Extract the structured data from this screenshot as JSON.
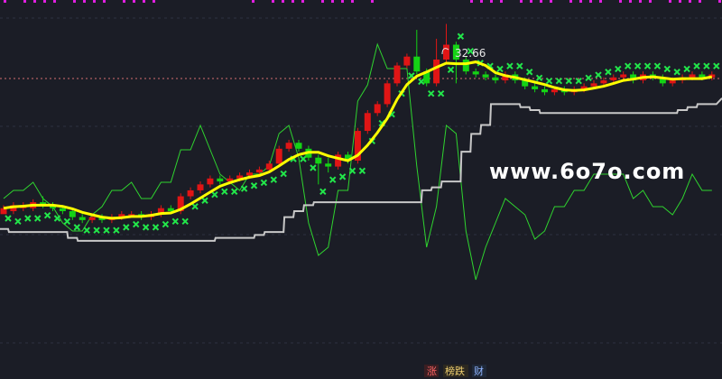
{
  "chart_data": {
    "type": "candlestick",
    "high_marker": "32.66",
    "watermark": "www.6o7o.com",
    "bottom_tabs": [
      "涨",
      "榜跌",
      "财"
    ],
    "colors": {
      "up": "#e01515",
      "down": "#15d315",
      "ma": "#ffff00",
      "lower": "#c8c8c8",
      "osc": "#2fd42f",
      "sar": "#22e64a",
      "ref": "#d67070"
    },
    "candles": [
      [
        56,
        58,
        59,
        57
      ],
      [
        57,
        59,
        60,
        56
      ],
      [
        58,
        59,
        60,
        57
      ],
      [
        58,
        60,
        61,
        57
      ],
      [
        60,
        59,
        62,
        58
      ],
      [
        59,
        58,
        60,
        57
      ],
      [
        58,
        57,
        59,
        56
      ],
      [
        57,
        55,
        58,
        54
      ],
      [
        55,
        54,
        56,
        53
      ],
      [
        54,
        55,
        56,
        53
      ],
      [
        55,
        54,
        56,
        53
      ],
      [
        54,
        55,
        56,
        53
      ],
      [
        55,
        56,
        57,
        54
      ],
      [
        56,
        56,
        57,
        55
      ],
      [
        56,
        55,
        57,
        54
      ],
      [
        55,
        56,
        57,
        54
      ],
      [
        56,
        58,
        59,
        55
      ],
      [
        58,
        57,
        59,
        56
      ],
      [
        57,
        62,
        63,
        56
      ],
      [
        62,
        64,
        65,
        61
      ],
      [
        64,
        66,
        67,
        63
      ],
      [
        66,
        68,
        69,
        65
      ],
      [
        68,
        67,
        69,
        66
      ],
      [
        67,
        68,
        69,
        66
      ],
      [
        68,
        69,
        70,
        67
      ],
      [
        69,
        70,
        71,
        68
      ],
      [
        70,
        71,
        72,
        69
      ],
      [
        71,
        73,
        74,
        70
      ],
      [
        73,
        78,
        79,
        72
      ],
      [
        78,
        80,
        81,
        77
      ],
      [
        80,
        78,
        81,
        77
      ],
      [
        78,
        75,
        79,
        74
      ],
      [
        75,
        73,
        76,
        66
      ],
      [
        73,
        72,
        75,
        70
      ],
      [
        72,
        76,
        77,
        71
      ],
      [
        76,
        74,
        77,
        73
      ],
      [
        74,
        84,
        85,
        73
      ],
      [
        84,
        90,
        91,
        83
      ],
      [
        90,
        93,
        94,
        89
      ],
      [
        93,
        100,
        101,
        92
      ],
      [
        100,
        106,
        107,
        99
      ],
      [
        106,
        109,
        110,
        105
      ],
      [
        109,
        104,
        118,
        103
      ],
      [
        104,
        100,
        105,
        99
      ],
      [
        100,
        108,
        115,
        99
      ],
      [
        108,
        113,
        120,
        107
      ],
      [
        113,
        108,
        114,
        100
      ],
      [
        108,
        104,
        109,
        103
      ],
      [
        104,
        103,
        105,
        102
      ],
      [
        103,
        102,
        104,
        101
      ],
      [
        102,
        101,
        103,
        100
      ],
      [
        101,
        103,
        104,
        100
      ],
      [
        103,
        101,
        104,
        100
      ],
      [
        101,
        99,
        102,
        98
      ],
      [
        99,
        98,
        100,
        97
      ],
      [
        98,
        97,
        99,
        96
      ],
      [
        97,
        98,
        99,
        96
      ],
      [
        98,
        97,
        99,
        96
      ],
      [
        97,
        98,
        99,
        96
      ],
      [
        98,
        99,
        100,
        97
      ],
      [
        99,
        100,
        101,
        98
      ],
      [
        100,
        101,
        102,
        99
      ],
      [
        101,
        102,
        103,
        100
      ],
      [
        102,
        103,
        104,
        101
      ],
      [
        103,
        101,
        104,
        100
      ],
      [
        101,
        103,
        104,
        100
      ],
      [
        103,
        102,
        104,
        101
      ],
      [
        102,
        100,
        103,
        99
      ],
      [
        100,
        101,
        102,
        99
      ],
      [
        101,
        102,
        103,
        100
      ],
      [
        102,
        103,
        104,
        101
      ],
      [
        103,
        102,
        104,
        101
      ],
      [
        102,
        103,
        104,
        101
      ]
    ]
  }
}
